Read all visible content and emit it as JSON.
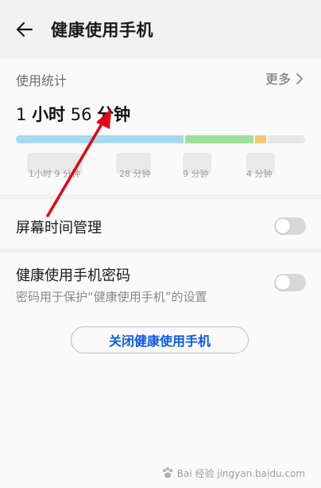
{
  "header": {
    "title": "健康使用手机",
    "back_icon": "arrow-left-icon"
  },
  "usage": {
    "label": "使用统计",
    "more": "更多",
    "total": {
      "hours": "1",
      "hours_unit": "小时",
      "minutes": "56",
      "minutes_unit": "分钟"
    },
    "bar": {
      "segments": [
        {
          "color": "#a6d9ef",
          "fraction": 0.59
        },
        {
          "color": "#9edf9a",
          "fraction": 0.24
        },
        {
          "color": "#f3c772",
          "fraction": 0.04
        },
        {
          "color": "#e6e6e6",
          "fraction": 0.13
        }
      ]
    },
    "legend": [
      "1小时 9 分钟",
      "28 分钟",
      "9 分钟",
      "4 分钟"
    ]
  },
  "screen_time": {
    "label": "屏幕时间管理",
    "enabled": false
  },
  "password": {
    "label": "健康使用手机密码",
    "sub": "密码用于保护“健康使用手机”的设置",
    "enabled": false
  },
  "close_button": {
    "label": "关闭健康使用手机"
  },
  "annotation": {
    "arrow_color": "#e60012"
  },
  "watermark": {
    "text": "Bai 经验 jingyan.baidu.com"
  },
  "colors": {
    "accent": "#0a59f7",
    "background": "#f2f2f2",
    "card": "#fafafa"
  }
}
